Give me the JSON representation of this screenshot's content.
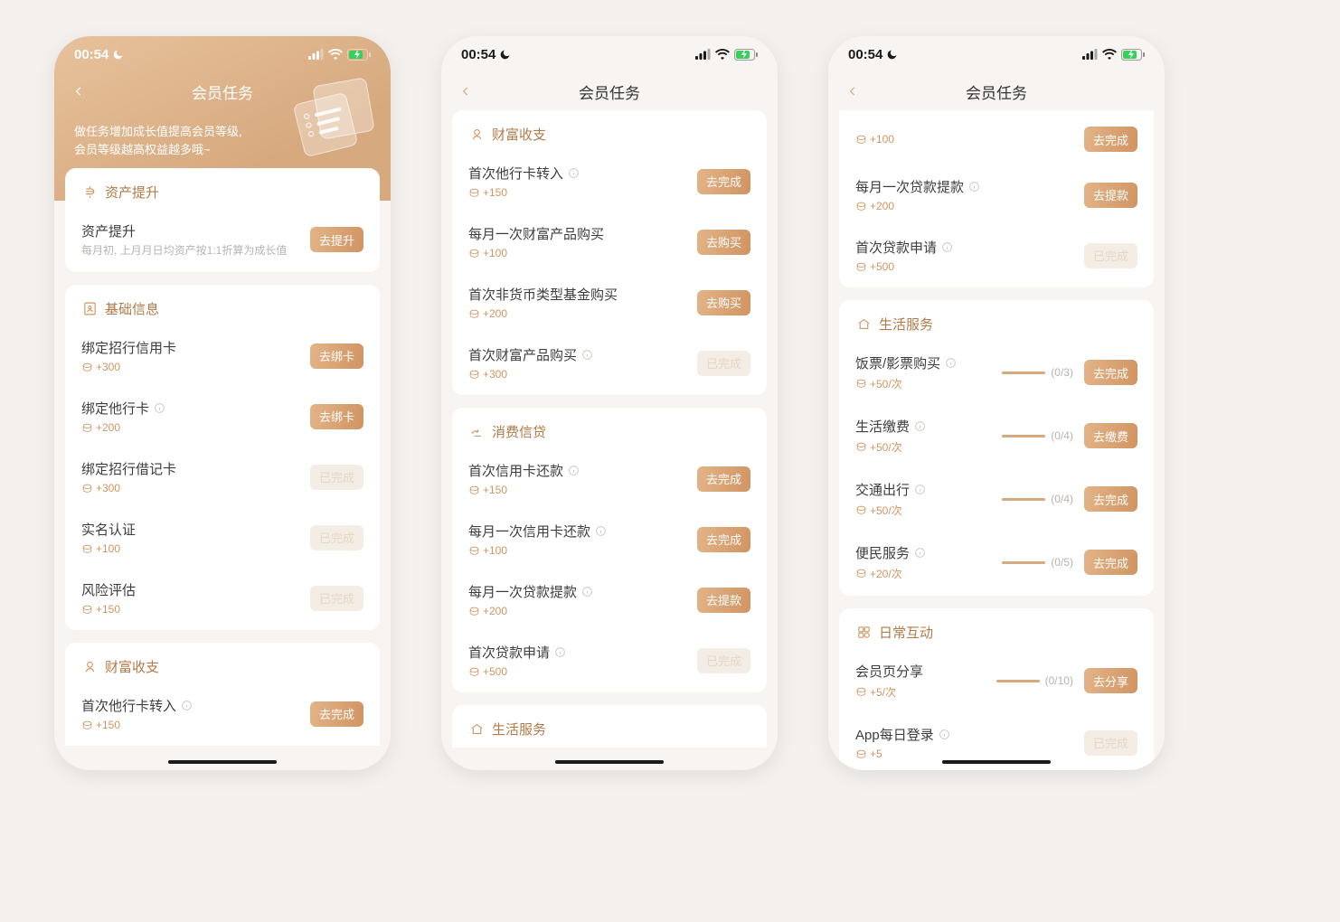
{
  "status": {
    "time": "00:54"
  },
  "nav": {
    "title": "会员任务"
  },
  "hero": {
    "line1": "做任务增加成长值提高会员等级,",
    "line2": "会员等级越高权益越多哦~"
  },
  "btn_done": "已完成",
  "screens": [
    {
      "gold_hero": true,
      "sections": [
        {
          "icon": "asset",
          "title": "资产提升",
          "rows": [
            {
              "title": "资产提升",
              "sub": "每月初, 上月月日均资产按1:1折算为成长值",
              "btn": "去提升",
              "state": "active"
            }
          ]
        },
        {
          "icon": "profile",
          "title": "基础信息",
          "rows": [
            {
              "title": "绑定招行信用卡",
              "reward": "+300",
              "btn": "去绑卡",
              "state": "active"
            },
            {
              "title": "绑定他行卡",
              "info": true,
              "reward": "+200",
              "btn": "去绑卡",
              "state": "active"
            },
            {
              "title": "绑定招行借记卡",
              "reward": "+300",
              "btn": "已完成",
              "state": "done"
            },
            {
              "title": "实名认证",
              "reward": "+100",
              "btn": "已完成",
              "state": "done"
            },
            {
              "title": "风险评估",
              "reward": "+150",
              "btn": "已完成",
              "state": "done"
            }
          ]
        },
        {
          "icon": "wealth",
          "title": "财富收支",
          "partial_bottom": true,
          "rows": [
            {
              "title": "首次他行卡转入",
              "info": true,
              "reward": "+150",
              "btn": "去完成",
              "state": "active"
            }
          ]
        }
      ]
    },
    {
      "gold_hero": false,
      "sections": [
        {
          "icon": "wealth",
          "title": "财富收支",
          "rows": [
            {
              "title": "首次他行卡转入",
              "info": true,
              "reward": "+150",
              "btn": "去完成",
              "state": "active"
            },
            {
              "title": "每月一次财富产品购买",
              "reward": "+100",
              "btn": "去购买",
              "state": "active"
            },
            {
              "title": "首次非货币类型基金购买",
              "reward": "+200",
              "btn": "去购买",
              "state": "active"
            },
            {
              "title": "首次财富产品购买",
              "info": true,
              "reward": "+300",
              "btn": "已完成",
              "state": "done"
            }
          ]
        },
        {
          "icon": "loan",
          "title": "消费信贷",
          "rows": [
            {
              "title": "首次信用卡还款",
              "info": true,
              "reward": "+150",
              "btn": "去完成",
              "state": "active"
            },
            {
              "title": "每月一次信用卡还款",
              "info": true,
              "reward": "+100",
              "btn": "去完成",
              "state": "active"
            },
            {
              "title": "每月一次贷款提款",
              "info": true,
              "reward": "+200",
              "btn": "去提款",
              "state": "active"
            },
            {
              "title": "首次贷款申请",
              "info": true,
              "reward": "+500",
              "btn": "已完成",
              "state": "done"
            }
          ]
        },
        {
          "icon": "life",
          "title": "生活服务",
          "partial_bottom": true,
          "head_only": true
        }
      ]
    },
    {
      "gold_hero": false,
      "sections": [
        {
          "icon": null,
          "title": null,
          "partial_top": true,
          "rows": [
            {
              "title": "",
              "reward": "+100",
              "btn": "去完成",
              "state": "active",
              "hidden_title": true
            },
            {
              "title": "每月一次贷款提款",
              "info": true,
              "reward": "+200",
              "btn": "去提款",
              "state": "active"
            },
            {
              "title": "首次贷款申请",
              "info": true,
              "reward": "+500",
              "btn": "已完成",
              "state": "done"
            }
          ]
        },
        {
          "icon": "life",
          "title": "生活服务",
          "rows": [
            {
              "title": "饭票/影票购买",
              "info": true,
              "reward": "+50/次",
              "progress": "(0/3)",
              "btn": "去完成",
              "state": "active"
            },
            {
              "title": "生活缴费",
              "info": true,
              "reward": "+50/次",
              "progress": "(0/4)",
              "btn": "去缴费",
              "state": "active"
            },
            {
              "title": "交通出行",
              "info": true,
              "reward": "+50/次",
              "progress": "(0/4)",
              "btn": "去完成",
              "state": "active"
            },
            {
              "title": "便民服务",
              "info": true,
              "reward": "+20/次",
              "progress": "(0/5)",
              "btn": "去完成",
              "state": "active"
            }
          ]
        },
        {
          "icon": "daily",
          "title": "日常互动",
          "partial_bottom": true,
          "rows": [
            {
              "title": "会员页分享",
              "reward": "+5/次",
              "progress": "(0/10)",
              "btn": "去分享",
              "state": "active"
            },
            {
              "title": "App每日登录",
              "info": true,
              "reward": "+5",
              "btn": "已完成",
              "state": "done"
            }
          ]
        }
      ]
    }
  ]
}
